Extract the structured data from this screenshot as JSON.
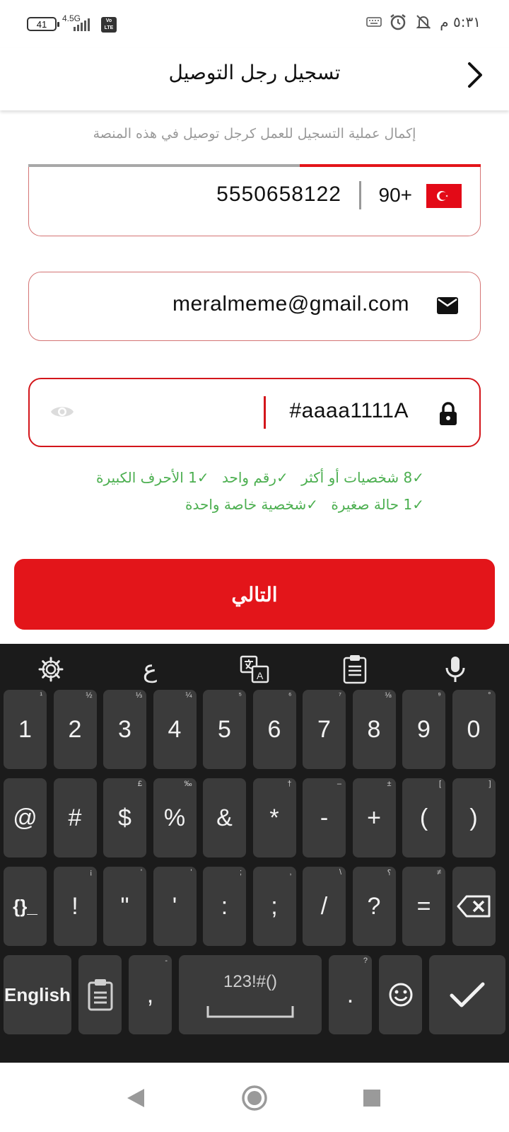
{
  "status_bar": {
    "battery": "41",
    "network": "4.5G",
    "volte": "Vo LTE",
    "time": "٥:٣١ م"
  },
  "header": {
    "title": "تسجيل رجل التوصيل",
    "subtitle": "إكمال عملية التسجيل للعمل كرجل توصيل في هذه المنصة",
    "progress": 0.4
  },
  "form": {
    "phone": {
      "country_code": "90+",
      "value": "5550658122"
    },
    "email": {
      "value": "meralmeme@gmail.com"
    },
    "password": {
      "value": "#aaaa1111A"
    }
  },
  "password_rules": [
    {
      "check": "✓",
      "label": "8 شخصيات أو أكثر"
    },
    {
      "check": "✓",
      "label": "رقم واحد"
    },
    {
      "check": "✓",
      "label": "1 الأحرف الكبيرة"
    },
    {
      "check": "✓",
      "label": "1 حالة صغيرة"
    },
    {
      "check": "✓",
      "label": "شخصية خاصة واحدة"
    }
  ],
  "next_button": "التالي",
  "keyboard": {
    "toolbar": {
      "arabic_key": "ع"
    },
    "row1": [
      {
        "label": "1",
        "hint": "¹"
      },
      {
        "label": "2",
        "hint": "½"
      },
      {
        "label": "3",
        "hint": "⅓"
      },
      {
        "label": "4",
        "hint": "¼"
      },
      {
        "label": "5",
        "hint": "⁵"
      },
      {
        "label": "6",
        "hint": "⁶"
      },
      {
        "label": "7",
        "hint": "⁷"
      },
      {
        "label": "8",
        "hint": "⅛"
      },
      {
        "label": "9",
        "hint": "⁹"
      },
      {
        "label": "0",
        "hint": "°"
      }
    ],
    "row2": [
      {
        "label": "@",
        "hint": ""
      },
      {
        "label": "#",
        "hint": ""
      },
      {
        "label": "$",
        "hint": "£"
      },
      {
        "label": "%",
        "hint": "‰"
      },
      {
        "label": "&",
        "hint": ""
      },
      {
        "label": "*",
        "hint": "†"
      },
      {
        "label": "-",
        "hint": "–"
      },
      {
        "label": "+",
        "hint": "±"
      },
      {
        "label": "(",
        "hint": "["
      },
      {
        "label": ")",
        "hint": "]"
      }
    ],
    "row3": [
      {
        "label": "{}_",
        "hint": ""
      },
      {
        "label": "!",
        "hint": "¡"
      },
      {
        "label": "\"",
        "hint": "'"
      },
      {
        "label": "'",
        "hint": "'"
      },
      {
        "label": ":",
        "hint": ";"
      },
      {
        "label": ";",
        "hint": ","
      },
      {
        "label": "/",
        "hint": "\\"
      },
      {
        "label": "?",
        "hint": "؟"
      },
      {
        "label": "=",
        "hint": "≠"
      }
    ],
    "bottom": {
      "language": "English",
      "comma": ",",
      "comma_hint": "-",
      "space": "123!#()",
      "period": ".",
      "period_hint": "?"
    }
  }
}
